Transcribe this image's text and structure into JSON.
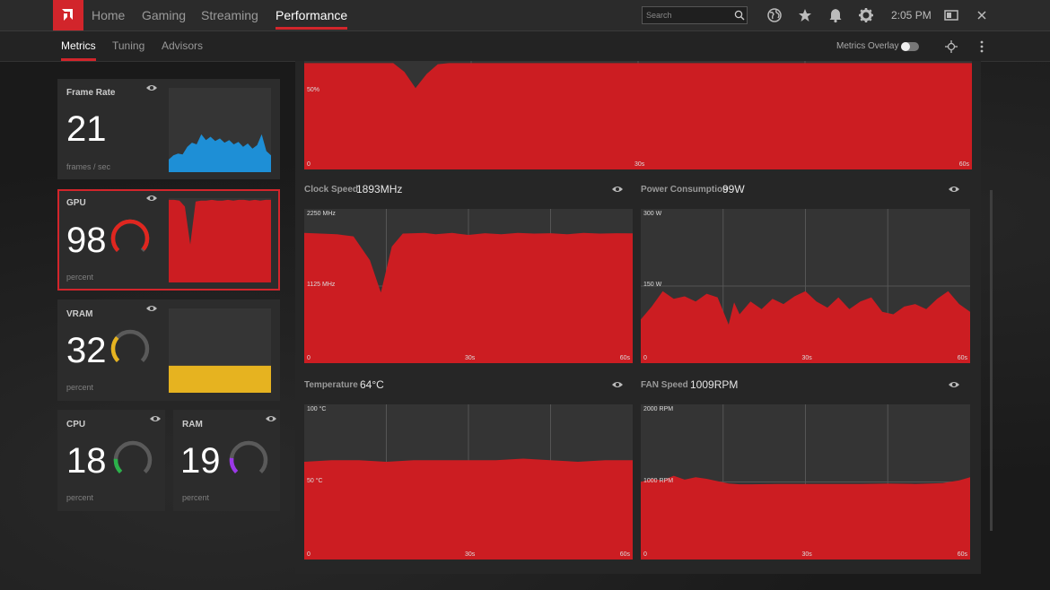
{
  "app": {
    "logo_icon": "amd-logo-icon",
    "accent_color": "#d2252b",
    "chart_fill_color": "#cc1d22",
    "nav_tabs": [
      {
        "label": "Home",
        "active": false
      },
      {
        "label": "Gaming",
        "active": false
      },
      {
        "label": "Streaming",
        "active": false
      },
      {
        "label": "Performance",
        "active": true
      }
    ],
    "search_placeholder": "Search",
    "icons": [
      "search-icon",
      "globe-icon",
      "star-icon",
      "bell-icon",
      "gear-icon",
      "minimize-window-icon",
      "close-icon"
    ],
    "clock": "2:05 PM"
  },
  "subnav": {
    "tabs": [
      {
        "label": "Metrics",
        "active": true
      },
      {
        "label": "Tuning",
        "active": false
      },
      {
        "label": "Advisors",
        "active": false
      }
    ],
    "overlay_label": "Metrics Overlay",
    "overlay_enabled": false,
    "icons": [
      "crosshair-icon",
      "more-vertical-icon"
    ]
  },
  "cards": {
    "frame_rate": {
      "title": "Frame Rate",
      "value": "21",
      "unit": "frames / sec",
      "color": "#1e8fd6",
      "mini_series": [
        0.15,
        0.2,
        0.22,
        0.21,
        0.3,
        0.35,
        0.33,
        0.45,
        0.38,
        0.42,
        0.37,
        0.4,
        0.35,
        0.38,
        0.33,
        0.36,
        0.3,
        0.34,
        0.28,
        0.32,
        0.45,
        0.25,
        0.2
      ]
    },
    "gpu": {
      "title": "GPU",
      "value": "98",
      "unit": "percent",
      "color": "#e0261f",
      "fraction": 0.98,
      "mini_series": [
        0.98,
        0.98,
        0.97,
        0.9,
        0.45,
        0.96,
        0.97,
        0.97,
        0.98,
        0.97,
        0.97,
        0.98,
        0.97,
        0.98,
        0.98,
        0.97,
        0.98,
        0.97,
        0.98,
        0.98
      ]
    },
    "vram": {
      "title": "VRAM",
      "value": "32",
      "unit": "percent",
      "color": "#e6b320",
      "fraction": 0.32,
      "mini_series": [
        0.32,
        0.32,
        0.32,
        0.32,
        0.32,
        0.32,
        0.32,
        0.32,
        0.32,
        0.32
      ]
    },
    "cpu": {
      "title": "CPU",
      "value": "18",
      "unit": "percent",
      "color": "#2bb24a",
      "fraction": 0.18
    },
    "ram": {
      "title": "RAM",
      "value": "19",
      "unit": "percent",
      "color": "#9b38e8",
      "fraction": 0.19
    }
  },
  "chart_data": [
    {
      "type": "area",
      "title": "",
      "value": "",
      "y_axis_labels": [
        "50%"
      ],
      "x_tick_labels": [
        "0",
        "30s",
        "60s"
      ],
      "x": [
        0,
        2,
        4,
        6,
        8,
        9,
        10,
        11,
        12,
        13,
        14,
        16,
        18,
        20,
        22,
        24,
        26,
        28,
        30,
        32,
        34,
        36,
        38,
        40,
        42,
        44,
        46,
        48,
        50,
        52,
        54,
        56,
        58,
        60
      ],
      "y": [
        98,
        98,
        98,
        98,
        98,
        90,
        75,
        88,
        97,
        98,
        98,
        98,
        98,
        98,
        98,
        98,
        98,
        98,
        98,
        98,
        98,
        98,
        98,
        98,
        98,
        98,
        98,
        98,
        98,
        98,
        98,
        98,
        98,
        98
      ],
      "ylim": [
        0,
        100
      ],
      "grid": true
    },
    {
      "type": "area",
      "title": "Clock Speed",
      "value": "1893MHz",
      "y_axis_labels": [
        "2250 MHz",
        "1125 MHz"
      ],
      "x_tick_labels": [
        "0",
        "30s",
        "60s"
      ],
      "x": [
        0,
        3,
        6,
        9,
        12,
        14,
        16,
        18,
        20,
        22,
        24,
        27,
        30,
        33,
        36,
        39,
        42,
        45,
        48,
        51,
        54,
        57,
        60
      ],
      "y": [
        1900,
        1890,
        1880,
        1850,
        1500,
        1030,
        1700,
        1890,
        1895,
        1900,
        1880,
        1900,
        1870,
        1895,
        1880,
        1900,
        1890,
        1895,
        1880,
        1900,
        1890,
        1895,
        1893
      ],
      "ylim": [
        0,
        2250
      ],
      "grid": true
    },
    {
      "type": "area",
      "title": "Power Consumption",
      "value": "99W",
      "y_axis_labels": [
        "300 W",
        "150 W"
      ],
      "x_tick_labels": [
        "0",
        "30s",
        "60s"
      ],
      "x": [
        0,
        2,
        4,
        6,
        8,
        10,
        12,
        14,
        16,
        17,
        18,
        20,
        22,
        24,
        26,
        28,
        30,
        32,
        34,
        36,
        38,
        40,
        42,
        44,
        46,
        48,
        50,
        52,
        54,
        56,
        58,
        60
      ],
      "y": [
        85,
        110,
        140,
        125,
        130,
        120,
        135,
        128,
        75,
        118,
        95,
        120,
        105,
        125,
        115,
        130,
        140,
        120,
        108,
        128,
        105,
        120,
        128,
        100,
        95,
        110,
        115,
        105,
        125,
        140,
        115,
        100
      ],
      "ylim": [
        0,
        300
      ],
      "grid": true
    },
    {
      "type": "area",
      "title": "Temperature",
      "value": "64°C",
      "y_axis_labels": [
        "100 °C",
        "50 °C"
      ],
      "x_tick_labels": [
        "0",
        "30s",
        "60s"
      ],
      "x": [
        0,
        5,
        10,
        15,
        20,
        25,
        30,
        35,
        40,
        45,
        50,
        55,
        60
      ],
      "y": [
        63,
        64,
        64,
        63,
        64,
        64,
        64,
        64,
        65,
        64,
        63,
        64,
        64
      ],
      "ylim": [
        0,
        100
      ],
      "grid": true
    },
    {
      "type": "area",
      "title": "FAN Speed",
      "value": "1009RPM",
      "y_axis_labels": [
        "2000 RPM",
        "1000 RPM"
      ],
      "x_tick_labels": [
        "0",
        "30s",
        "60s"
      ],
      "x": [
        0,
        2,
        4,
        6,
        8,
        10,
        12,
        14,
        16,
        18,
        20,
        25,
        30,
        35,
        40,
        45,
        50,
        55,
        58,
        60
      ],
      "y": [
        1000,
        1040,
        1020,
        1080,
        1030,
        1060,
        1040,
        1010,
        980,
        970,
        970,
        975,
        975,
        975,
        975,
        980,
        975,
        985,
        1020,
        1060
      ],
      "ylim": [
        0,
        2000
      ],
      "grid": true
    }
  ]
}
